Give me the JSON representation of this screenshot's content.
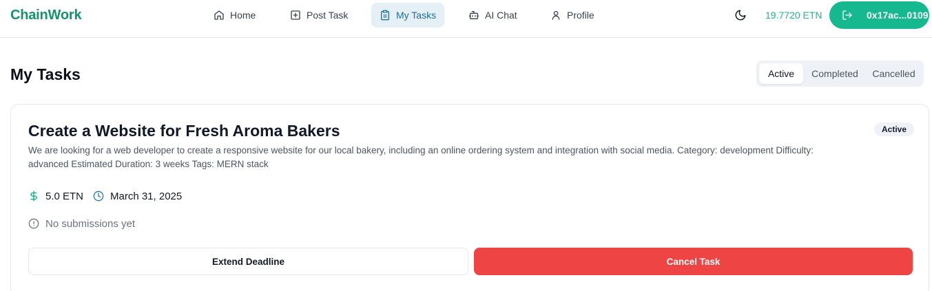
{
  "brand": "ChainWork",
  "nav": {
    "home": "Home",
    "post_task": "Post Task",
    "my_tasks": "My Tasks",
    "ai_chat": "AI Chat",
    "profile": "Profile"
  },
  "wallet": {
    "balance": "19.7720 ETN",
    "address": "0x17ac...0109"
  },
  "page": {
    "title": "My Tasks",
    "tabs": [
      "Active",
      "Completed",
      "Cancelled"
    ],
    "selected_tab": "Active"
  },
  "task": {
    "title": "Create a Website for Fresh Aroma Bakers",
    "status": "Active",
    "description": "We are looking for a web developer to create a responsive website for our local bakery, including an online ordering system and integration with social media. Category: development Difficulty: advanced Estimated Duration: 3 weeks Tags: MERN stack",
    "reward": "5.0 ETN",
    "deadline": "March 31, 2025",
    "submissions": "No submissions yet",
    "extend_label": "Extend Deadline",
    "cancel_label": "Cancel Task"
  },
  "icons": {
    "home": "home-icon",
    "post_task": "plus-square-icon",
    "my_tasks": "clipboard-icon",
    "ai_chat": "bot-icon",
    "profile": "user-icon",
    "theme": "moon-icon",
    "wallet": "logout-icon",
    "reward": "dollar-icon",
    "deadline": "clock-icon",
    "submissions": "alert-circle-icon"
  },
  "colors": {
    "brand": "#15936b",
    "accent": "#15b88f",
    "active_nav_bg": "#e4eff6",
    "danger": "#ef4444"
  }
}
